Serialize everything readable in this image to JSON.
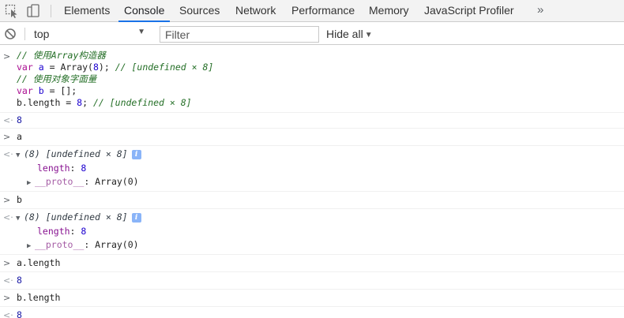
{
  "tabs": {
    "inspect_icon": "cursor-select-icon",
    "device_icon": "device-toolbar-icon",
    "items": [
      "Elements",
      "Console",
      "Sources",
      "Network",
      "Performance",
      "Memory",
      "JavaScript Profiler"
    ],
    "active": "Console",
    "more": "»"
  },
  "toolbar": {
    "clear_icon": "block-icon",
    "context": "top",
    "filter_placeholder": "Filter",
    "levels_label": "Hide all"
  },
  "log": {
    "entry1": {
      "comment1": "// 使用Array构造器",
      "kw1": "var",
      "var_a": "a",
      "code1a": " = ",
      "array_call": "Array(",
      "num8a": "8",
      "code1b": ");",
      "comment2": " // [undefined × 8]",
      "comment3": "// 使用对象字面量",
      "kw2": "var",
      "var_b": "b",
      "code2": " = [];",
      "code3a": "b.length = ",
      "num8b": "8",
      "code3b": ";",
      "comment4": " // [undefined × 8]",
      "result": "8"
    },
    "entry2": {
      "input": "a",
      "summary": "(8) [undefined × 8]",
      "length_key": "length",
      "length_val": "8",
      "proto_key": "__proto__",
      "proto_val": "Array(0)"
    },
    "entry3": {
      "input": "b",
      "summary": "(8) [undefined × 8]",
      "length_key": "length",
      "length_val": "8",
      "proto_key": "__proto__",
      "proto_val": "Array(0)"
    },
    "entry4": {
      "input": "a.length",
      "result": "8"
    },
    "entry5": {
      "input": "b.length",
      "result": "8"
    }
  },
  "colors": {
    "accent": "#1a73e8",
    "comment": "#236e25",
    "keyword": "#aa0d91",
    "number": "#1c00cf",
    "property": "#881391"
  }
}
